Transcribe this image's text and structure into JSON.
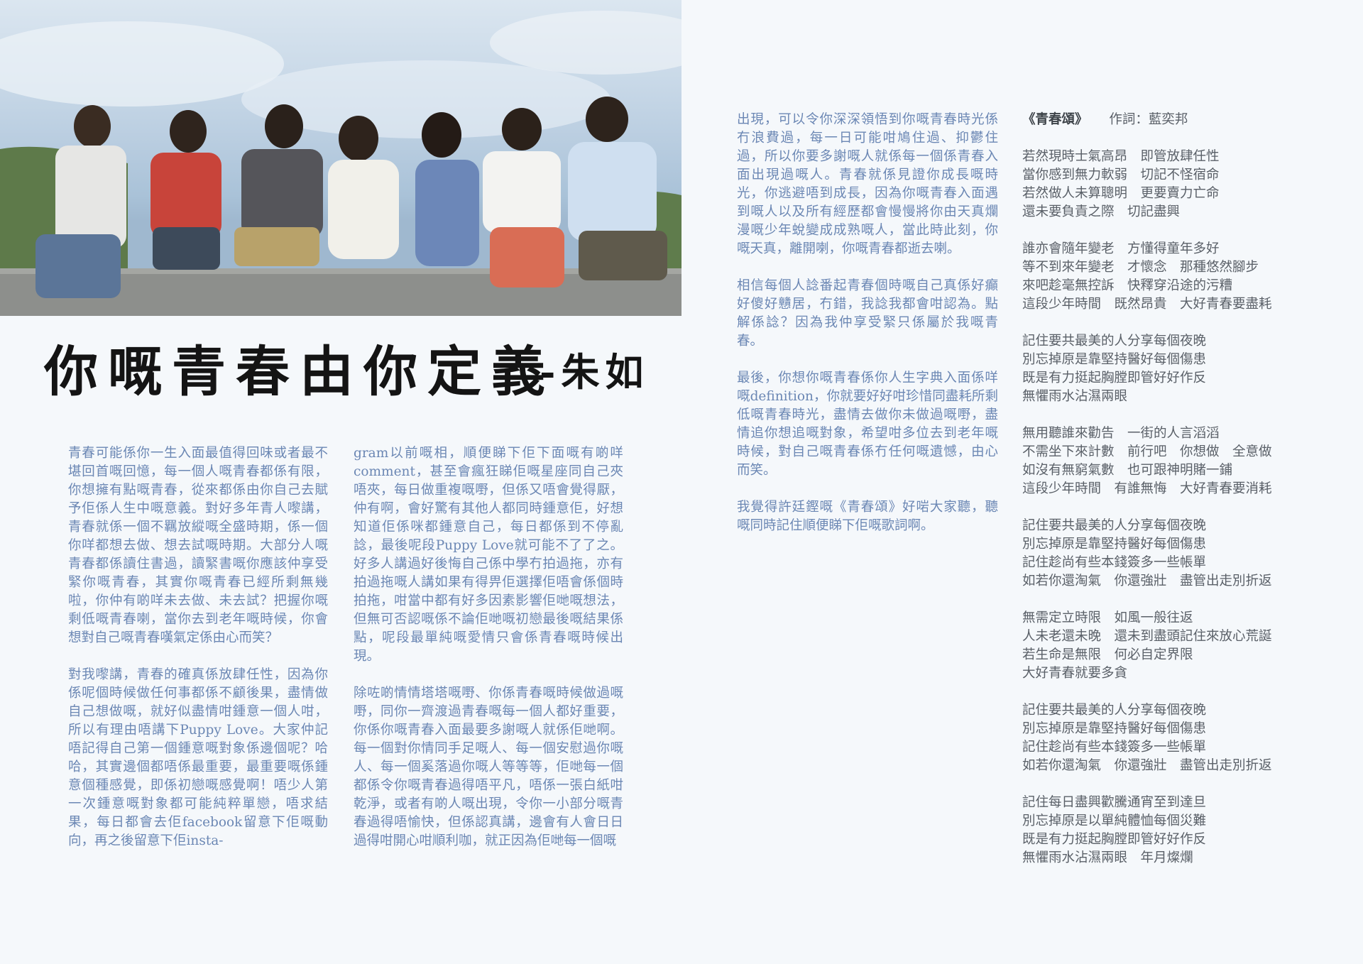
{
  "article": {
    "title": "你嘅青春由你定義",
    "author": "-朱如",
    "paragraphs_col1": [
      "青春可能係你一生入面最值得回味或者最不堪回首嘅回憶，每一個人嘅青春都係有限，你想擁有點嘅青春，從來都係由你自己去賦予佢係人生中嘅意義。對好多年青人嚟講，青春就係一個不羈放縱嘅全盛時期，係一個你咩都想去做、想去試嘅時期。大部分人嘅青春都係讀住書過，讀緊書嘅你應該仲享受緊你嘅青春，其實你嘅青春已經所剩無幾啦，你仲有啲咩未去做、未去試？把握你嘅剩低嘅青春喇，當你去到老年嘅時候，你會想對自己嘅青春嘆氣定係由心而笑？",
      "對我嚟講，青春的確真係放肆任性，因為你係呢個時候做任何事都係不顧後果，盡情做自己想做嘅，就好似盡情咁鍾意一個人咁，所以有理由唔講下Puppy Love。大家仲記唔記得自己第一個鍾意嘅對象係邊個呢？哈哈，其實邊個都唔係最重要，最重要嘅係鍾意個種感覺，即係初戀嘅感覺啊！唔少人第一次鍾意嘅對象都可能純粹單戀，唔求結果，每日都會去佢facebook留意下佢嘅動向，再之後留意下佢insta-"
    ],
    "paragraphs_col2": [
      "gram以前嘅相，順便睇下佢下面嘅有啲咩comment，甚至會瘋狂睇佢嘅星座同自己夾唔夾，每日做重複嘅嘢，但係又唔會覺得厭，仲有啊，會好驚有其他人都同時鍾意佢，好想知道佢係咪都鍾意自己，每日都係到不停亂諗，最後呢段Puppy Love就可能不了了之。好多人講過好後悔自己係中學冇拍過拖，亦有拍過拖嘅人講如果有得畀佢選擇佢唔會係個時拍拖，咁當中都有好多因素影響佢哋嘅想法，但無可否認嘅係不論佢哋嘅初戀最後嘅結果係點，呢段最單純嘅愛情只會係青春嘅時候出現。",
      "除咗啲情情塔塔嘅嘢、你係青春嘅時候做過嘅嘢，同你一齊渡過青春嘅每一個人都好重要，你係你嘅青春入面最要多謝嘅人就係佢哋啊。每一個對你情同手足嘅人、每一個安慰過你嘅人、每一個奚落過你嘅人等等等，佢哋每一個都係令你嘅青春過得唔平凡，唔係一張白紙咁乾淨，或者有啲人嘅出現，令你一小部分嘅青春過得唔愉快，但係認真講，邊會有人會日日過得咁開心咁順利咖，就正因為佢哋每一個嘅"
    ],
    "paragraphs_col3": [
      "出現，可以令你深深領悟到你嘅青春時光係冇浪費過，每一日可能咁鳩住過、抑鬱住過，所以你要多謝嘅人就係每一個係青春入面出現過嘅人。青春就係見證你成長嘅時光，你逃避唔到成長，因為你嘅青春入面遇到嘅人以及所有經歷都會慢慢將你由天真爛漫嘅少年蛻變成成熟嘅人，當此時此刻，你嘅天真，離開喇，你嘅青春都逝去喇。",
      "相信每個人諗番起青春個時嘅自己真係好癲好傻好戇居，冇錯，我諗我都會咁認為。點解係諗？因為我仲享受緊只係屬於我嘅青春。",
      "最後，你想你嘅青春係你人生字典入面係咩嘅definition，你就要好好咁珍惜同盡耗所剩低嘅青春時光，盡情去做你未做過嘅嘢，盡情追你想追嘅對象，希望咁多位去到老年嘅時候，對自己嘅青春係冇任何嘅遺憾，由心而笑。",
      "我覺得許廷鏗嘅《青春頌》好啱大家聽，聽嘅同時記住順便睇下佢嘅歌詞啊。"
    ]
  },
  "lyrics": {
    "song": "《青春頌》",
    "credit": "作詞：藍奕邦",
    "stanzas": [
      [
        "若然現時士氣高昂　即管放肆任性",
        "當你感到無力軟弱　切記不怪宿命",
        "若然做人未算聰明　更要賣力亡命",
        "還未要負責之際　切記盡興"
      ],
      [
        "誰亦會隨年變老　方懂得童年多好",
        "等不到來年變老　才懷念　那種悠然腳步",
        "來吧趁毫無控訴　快釋穿沿途的污糟",
        "這段少年時間　既然昂貴　大好青春要盡耗"
      ],
      [
        "記住要共最美的人分享每個夜晚",
        "別忘掉原是靠堅持醫好每個傷患",
        "既是有力挺起胸膛即管好好作反",
        "無懼雨水沾濕兩眼"
      ],
      [
        "無用聽誰來勸告　一街的人言滔滔",
        "不需坐下來計數　前行吧　你想做　全意做",
        "如沒有無窮氣數　也可跟神明賭一鋪",
        "這段少年時間　有誰無悔　大好青春要消耗"
      ],
      [
        "記住要共最美的人分享每個夜晚",
        "別忘掉原是靠堅持醫好每個傷患",
        "記住趁尚有些本錢簽多一些帳單",
        "如若你還淘氣　你還強壯　盡管出走別折返"
      ],
      [
        "無需定立時限　如風一般往返",
        "人未老還未晚　還未到盡頭記住來放心荒誕",
        "若生命是無限　何必自定界限",
        "大好青春就要多貪"
      ],
      [
        "記住要共最美的人分享每個夜晚",
        "別忘掉原是靠堅持醫好每個傷患",
        "記住趁尚有些本錢簽多一些帳單",
        "如若你還淘氣　你還強壯　盡管出走別折返"
      ],
      [
        "記住每日盡興歡騰通宵至到達旦",
        "別忘掉原是以單純體恤每個災難",
        "既是有力挺起胸膛即管好好作反",
        "無懼雨水沾濕兩眼　年月燦爛"
      ]
    ]
  },
  "colors": {
    "body_text": "#6b87b4",
    "lyrics_text": "#5a6068",
    "title": "#141414",
    "page": "#f5f8fb"
  }
}
